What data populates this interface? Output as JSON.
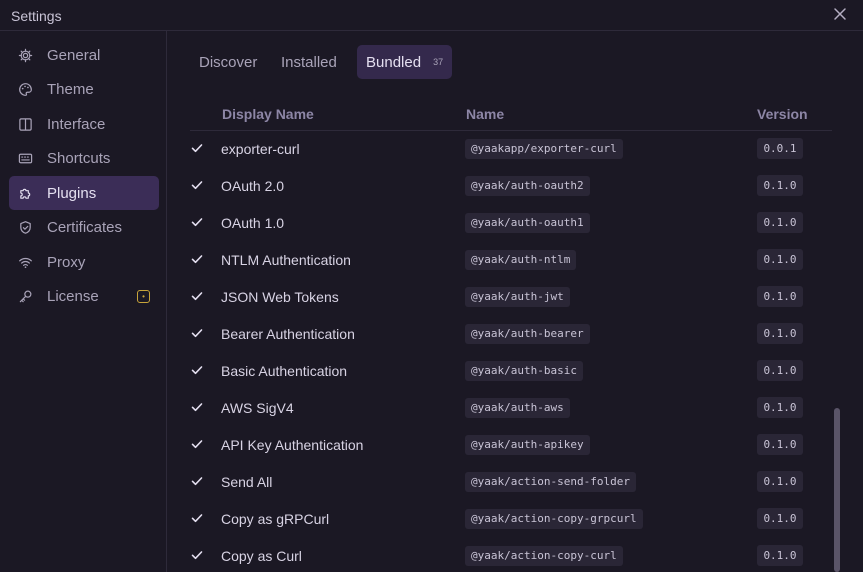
{
  "window": {
    "title": "Settings"
  },
  "sidebar": {
    "items": [
      {
        "label": "General",
        "icon": "gear-icon",
        "active": false
      },
      {
        "label": "Theme",
        "icon": "palette-icon",
        "active": false
      },
      {
        "label": "Interface",
        "icon": "columns-icon",
        "active": false
      },
      {
        "label": "Shortcuts",
        "icon": "keyboard-icon",
        "active": false
      },
      {
        "label": "Plugins",
        "icon": "puzzle-icon",
        "active": true
      },
      {
        "label": "Certificates",
        "icon": "shield-check-icon",
        "active": false
      },
      {
        "label": "Proxy",
        "icon": "wifi-icon",
        "active": false
      },
      {
        "label": "License",
        "icon": "key-icon",
        "active": false
      }
    ]
  },
  "tabs": [
    {
      "label": "Discover",
      "active": false
    },
    {
      "label": "Installed",
      "active": false
    },
    {
      "label": "Bundled",
      "count": "37",
      "active": true
    }
  ],
  "table": {
    "headers": {
      "display_name": "Display Name",
      "name": "Name",
      "version": "Version"
    },
    "rows": [
      {
        "checked": true,
        "display": "exporter-curl",
        "name": "@yaakapp/exporter-curl",
        "version": "0.0.1"
      },
      {
        "checked": true,
        "display": "OAuth 2.0",
        "name": "@yaak/auth-oauth2",
        "version": "0.1.0"
      },
      {
        "checked": true,
        "display": "OAuth 1.0",
        "name": "@yaak/auth-oauth1",
        "version": "0.1.0"
      },
      {
        "checked": true,
        "display": "NTLM Authentication",
        "name": "@yaak/auth-ntlm",
        "version": "0.1.0"
      },
      {
        "checked": true,
        "display": "JSON Web Tokens",
        "name": "@yaak/auth-jwt",
        "version": "0.1.0"
      },
      {
        "checked": true,
        "display": "Bearer Authentication",
        "name": "@yaak/auth-bearer",
        "version": "0.1.0"
      },
      {
        "checked": true,
        "display": "Basic Authentication",
        "name": "@yaak/auth-basic",
        "version": "0.1.0"
      },
      {
        "checked": true,
        "display": "AWS SigV4",
        "name": "@yaak/auth-aws",
        "version": "0.1.0"
      },
      {
        "checked": true,
        "display": "API Key Authentication",
        "name": "@yaak/auth-apikey",
        "version": "0.1.0"
      },
      {
        "checked": true,
        "display": "Send All",
        "name": "@yaak/action-send-folder",
        "version": "0.1.0"
      },
      {
        "checked": true,
        "display": "Copy as gRPCurl",
        "name": "@yaak/action-copy-grpcurl",
        "version": "0.1.0"
      },
      {
        "checked": true,
        "display": "Copy as Curl",
        "name": "@yaak/action-copy-curl",
        "version": "0.1.0"
      }
    ]
  },
  "colors": {
    "accent": "#3b2d57",
    "background": "#1b1824",
    "badge": "#c8a43a"
  }
}
